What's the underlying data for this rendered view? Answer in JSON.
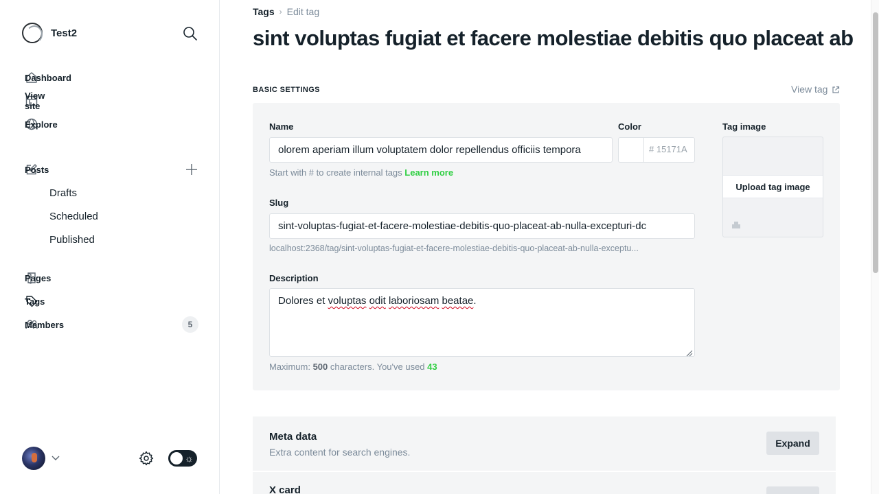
{
  "sidebar": {
    "site_name": "Test2",
    "nav": {
      "dashboard": "Dashboard",
      "view_site": "View site",
      "explore": "Explore",
      "posts": "Posts",
      "drafts": "Drafts",
      "scheduled": "Scheduled",
      "published": "Published",
      "pages": "Pages",
      "tags": "Tags",
      "members": "Members",
      "members_count": "5"
    },
    "active_item": "Tags"
  },
  "breadcrumb": {
    "parent": "Tags",
    "current": "Edit tag"
  },
  "page_title": "sint voluptas fugiat et facere molestiae debitis quo placeat ab",
  "basic_settings": {
    "section_title": "BASIC SETTINGS",
    "view_tag": "View tag",
    "name_label": "Name",
    "name_value": "olorem aperiam illum voluptatem dolor repellendus officiis tempora",
    "name_hint": "Start with # to create internal tags",
    "learn_more": "Learn more",
    "color_label": "Color",
    "color_hash": "#",
    "color_value": "15171A",
    "tag_image_label": "Tag image",
    "upload_label": "Upload tag image",
    "slug_label": "Slug",
    "slug_value": "sint-voluptas-fugiat-et-facere-molestiae-debitis-quo-placeat-ab-nulla-excepturi-dc",
    "slug_url": "localhost:2368/tag/sint-voluptas-fugiat-et-facere-molestiae-debitis-quo-placeat-ab-nulla-exceptu...",
    "description_label": "Description",
    "description_words": [
      "Dolores et ",
      "voluptas",
      " ",
      "odit",
      " ",
      "laboriosam",
      " ",
      "beatae",
      "."
    ],
    "char_prefix": "Maximum:",
    "char_max": "500",
    "char_middle": "characters. You've used",
    "char_used": "43"
  },
  "meta_card": {
    "title": "Meta data",
    "subtitle": "Extra content for search engines.",
    "expand": "Expand"
  },
  "x_card": {
    "title": "X card"
  },
  "colors": {
    "accent_green": "#30cf43",
    "panel_bg": "#f4f5f6",
    "text": "#15212a"
  }
}
